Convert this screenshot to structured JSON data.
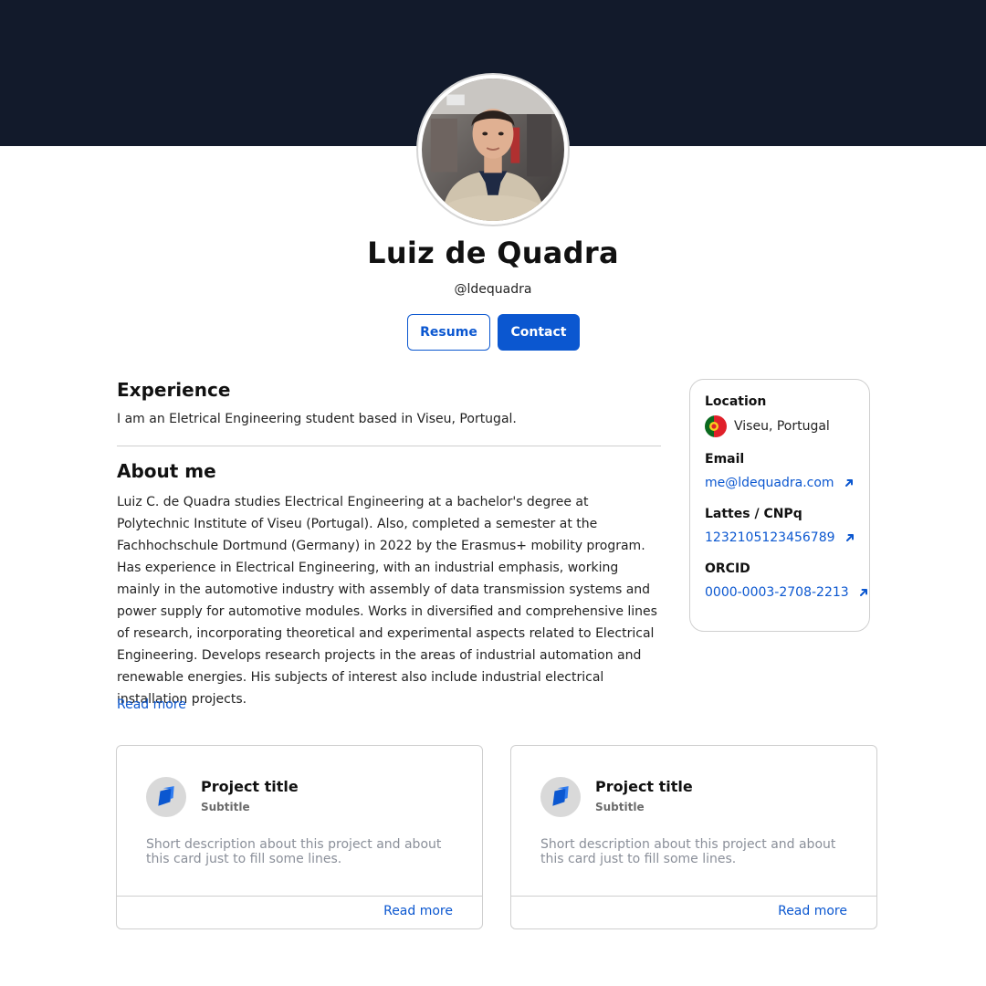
{
  "profile": {
    "name": "Luiz de Quadra",
    "handle": "@ldequadra",
    "avatar_icon": "profile-photo"
  },
  "actions": {
    "resume_label": "Resume",
    "contact_label": "Contact"
  },
  "experience": {
    "title": "Experience",
    "text": "I am an Eletrical Engineering student based in Viseu, Portugal."
  },
  "about": {
    "title": "About me",
    "text": "Luiz C. de Quadra studies Electrical Engineering at a bachelor's degree at Polytechnic Institute of Viseu (Portugal). Also, completed a semester at the Fachhochschule Dortmund (Germany) in 2022 by the Erasmus+ mobility program. Has experience in Electrical Engineering, with an industrial emphasis, working mainly in the automotive industry with assembly of data transmission systems and power supply for automotive modules. Works in diversified and comprehensive lines of research, incorporating theoretical and experimental aspects related to Electrical Engineering. Develops research projects in the areas of industrial automation and renewable energies. His subjects of interest also include industrial electrical installation projects.",
    "read_more": "Read more"
  },
  "sidebar": {
    "location_label": "Location",
    "location_value": "Viseu, Portugal",
    "location_icon": "portugal-flag",
    "email_label": "Email",
    "email_value": "me@ldequadra.com",
    "lattes_label": "Lattes / CNPq",
    "lattes_value": "1232105123456789",
    "orcid_label": "ORCID",
    "orcid_value": "0000-0003-2708-2213",
    "link_icon": "external-link-icon"
  },
  "projects": [
    {
      "title": "Project title",
      "subtitle": "Subtitle",
      "description": "Short description about this project and about this card just to fill some lines.",
      "read_more": "Read more",
      "icon": "project-icon"
    },
    {
      "title": "Project title",
      "subtitle": "Subtitle",
      "description": "Short description about this project and about this card just to fill some lines.",
      "read_more": "Read more",
      "icon": "project-icon"
    }
  ],
  "colors": {
    "hero": "#121a2b",
    "accent": "#0b57d0",
    "border": "#cfcfcf"
  }
}
